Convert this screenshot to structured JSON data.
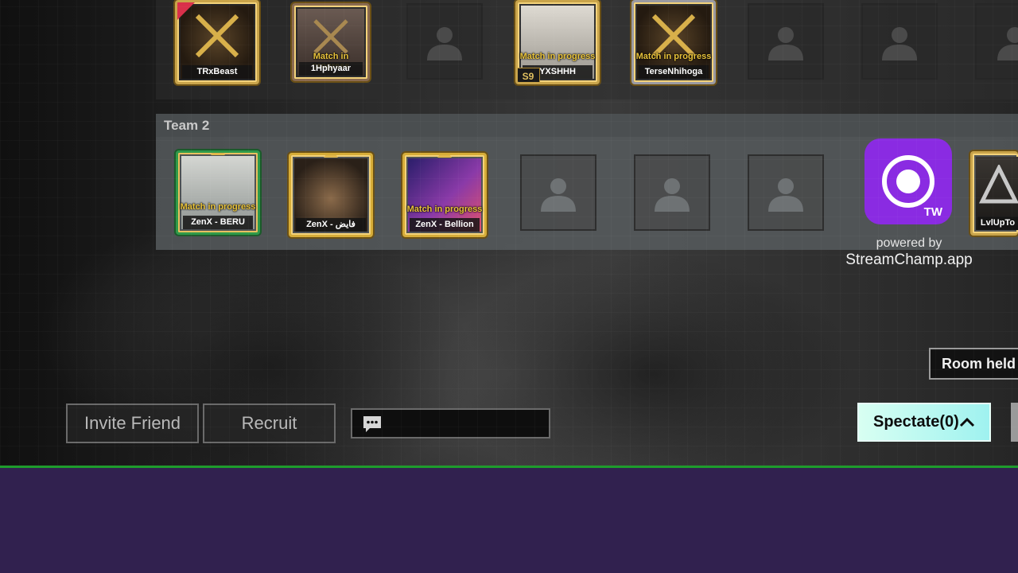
{
  "team1": {
    "players": [
      {
        "name": "TRxBeast",
        "status": ""
      },
      {
        "name": "1Hphyaar",
        "status": "Match in progress"
      },
      {
        "name": "YXSHHH",
        "status": "Match in progress",
        "tier": "S9"
      },
      {
        "name": "TerseNhihoga",
        "status": "Match in progress"
      }
    ]
  },
  "team2": {
    "title": "Team 2",
    "players": [
      {
        "name": "ZenX - BERU",
        "status": "Match in progress"
      },
      {
        "name": "ZenX - فایض",
        "status": ""
      },
      {
        "name": "ZenX - Bellion",
        "status": "Match in progress"
      },
      {
        "name": "LvlUpTo",
        "status": ""
      }
    ]
  },
  "overlay": {
    "logo_text": "TW",
    "powered_by": "powered by",
    "site": "StreamChamp.app"
  },
  "room_held": "Room held fo",
  "buttons": {
    "invite_friend": "Invite Friend",
    "recruit": "Recruit",
    "spectate": "Spectate(0)"
  },
  "colors": {
    "accent_gold": "#c9a44a",
    "spectate_bg": "#bff7ef",
    "stream_bar": "#31214f",
    "stream_bar_border": "#1e9c2c",
    "logo_purple": "#8a2be2"
  },
  "icons": [
    "person-placeholder-icon",
    "chat-icon",
    "chevron-up-icon",
    "crossed-swords-icon",
    "home-flag-icon"
  ]
}
